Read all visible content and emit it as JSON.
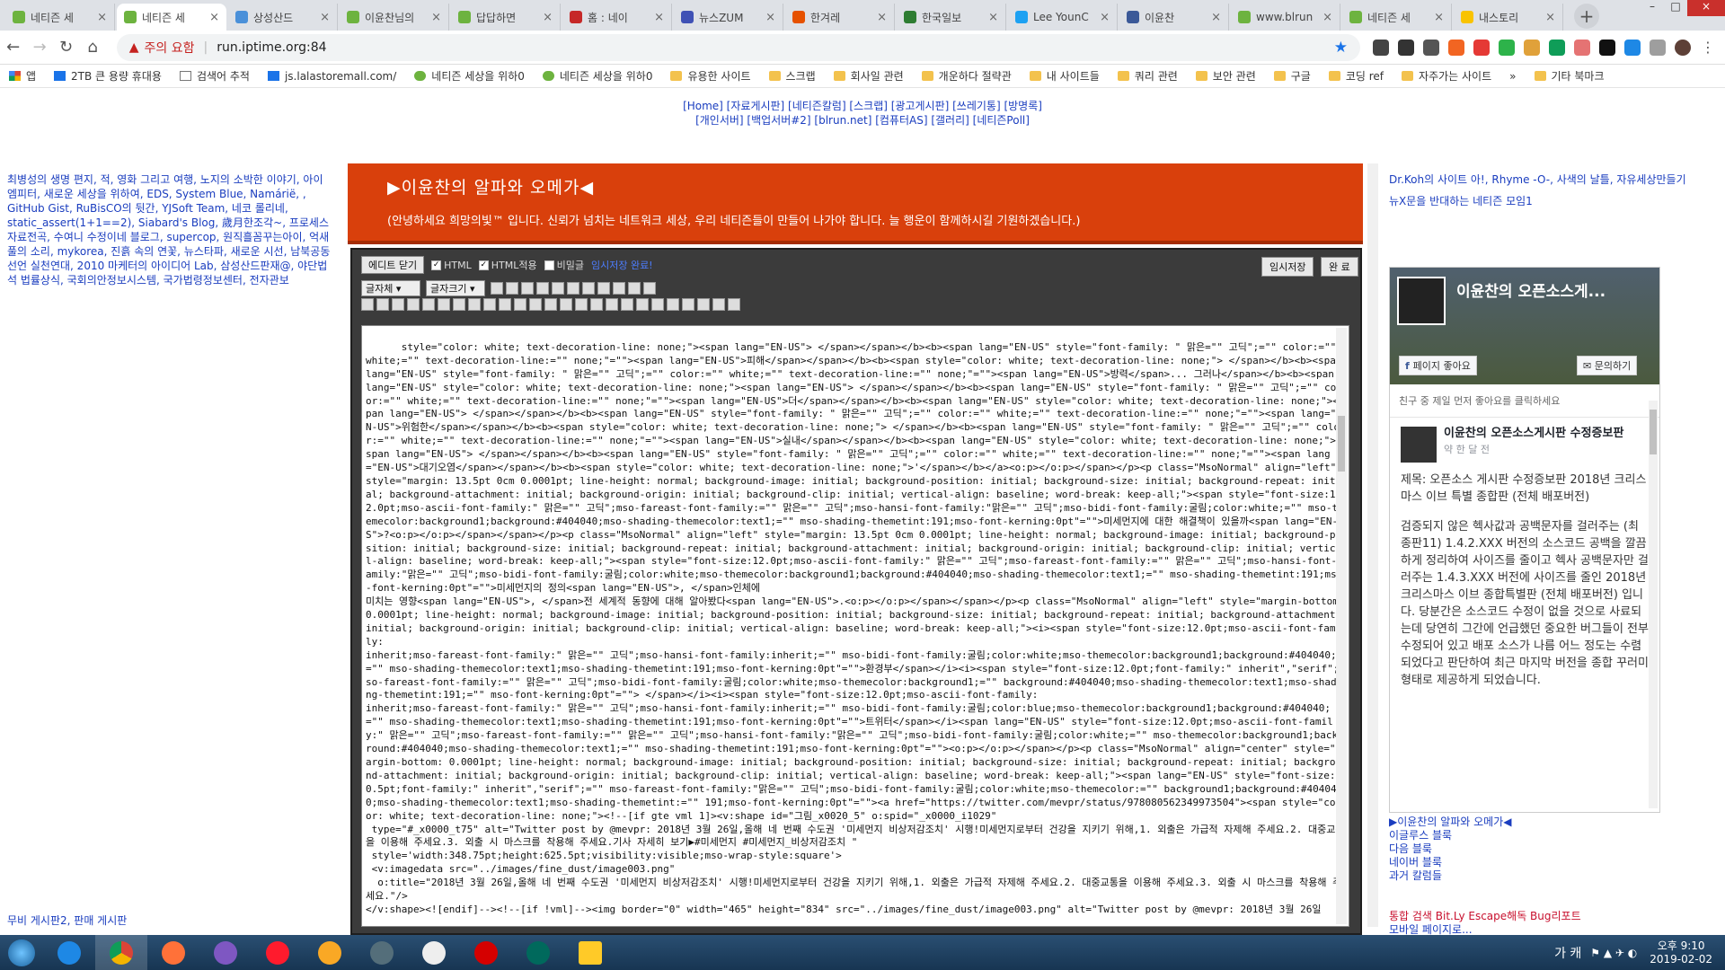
{
  "browser": {
    "tabs": [
      {
        "title": "네티즌 세",
        "color": "#6db33f",
        "icon": "leaf-icon"
      },
      {
        "title": "네티즌 세",
        "color": "#6db33f",
        "icon": "leaf-icon",
        "active": true
      },
      {
        "title": "상성산드",
        "color": "#4a90d9",
        "icon": "globe-icon"
      },
      {
        "title": "이윤찬님의",
        "color": "#6db33f",
        "icon": "leaf-icon"
      },
      {
        "title": "답답하면",
        "color": "#6db33f",
        "icon": "leaf-icon"
      },
      {
        "title": "홈 : 네이",
        "color": "#c62828",
        "icon": "shield-icon"
      },
      {
        "title": "뉴스ZUM",
        "color": "#3f51b5",
        "icon": "zum-icon"
      },
      {
        "title": "한겨레",
        "color": "#e65100",
        "icon": "newspaper-icon"
      },
      {
        "title": "한국일보",
        "color": "#2e7d32",
        "icon": "newspaper-icon"
      },
      {
        "title": "Lee YounC",
        "color": "#1da1f2",
        "icon": "twitter-icon"
      },
      {
        "title": "이윤찬",
        "color": "#3b5998",
        "icon": "facebook-icon"
      },
      {
        "title": "www.blrun",
        "color": "#6db33f",
        "icon": "leaf-icon"
      },
      {
        "title": "네티즌 세",
        "color": "#6db33f",
        "icon": "leaf-icon"
      },
      {
        "title": "내스토리",
        "color": "#f9c300",
        "icon": "story-icon"
      }
    ],
    "address": {
      "warning": "주의 요함",
      "url": "run.iptime.org:84"
    },
    "bookmarks": [
      {
        "label": "앱",
        "type": "apps"
      },
      {
        "label": "2TB 큰 용량 휴대용",
        "type": "u"
      },
      {
        "label": "검색어 추적",
        "type": "page"
      },
      {
        "label": "js.lalastoremall.com/",
        "type": "u"
      },
      {
        "label": "네티즌 세상을 위하0",
        "type": "leaf"
      },
      {
        "label": "네티즌 세상을 위하0",
        "type": "leaf"
      },
      {
        "label": "유용한 사이트",
        "type": "folder"
      },
      {
        "label": "스크랩",
        "type": "folder"
      },
      {
        "label": "회사일 관련",
        "type": "folder"
      },
      {
        "label": "개운하다 절략관",
        "type": "folder"
      },
      {
        "label": "내 사이트들",
        "type": "folder"
      },
      {
        "label": "쿼리 관련",
        "type": "folder"
      },
      {
        "label": "보안 관련",
        "type": "folder"
      },
      {
        "label": "구글",
        "type": "folder"
      },
      {
        "label": "코딩 ref",
        "type": "folder"
      },
      {
        "label": "자주가는 사이트",
        "type": "folder"
      },
      {
        "label": "»",
        "type": "more"
      },
      {
        "label": "기타 북마크",
        "type": "folder"
      }
    ]
  },
  "site": {
    "toplinks_line1": "[Home] [자료게시판] [네티즌칼럼] [스크랩] [광고게시판] [쓰레기통] [방명록]",
    "toplinks_line2": "[개인서버] [백업서버#2] [blrun.net] [컴퓨터AS] [갤러리] [네티즌Poll]",
    "leftcol": "최병성의 생명 편지, 적, 영화 그리고 여행, 노지의 소박한 이야기, 아이엠피터, 새로운 세상을 위하여, EDS, System Blue, Namárië, , GitHub Gist, RuBisCO의 뒷간, YJSoft Team, 네코 롤리네, static_assert(1+1==2), Siabard's Blog, 歲月한조각~, 프로세스 자료전곡, 수여니 수정이네 블로그, supercop, 원직흘꼼꾸는아이, 억새풀의 소리, mykorea, 진흙 속의 연꽃, 뉴스타파, 새로운 시선, 남북공동선언 실천연대, 2010 마케터의 아이디어 Lab, 삼성산드판재@, 야단법석 법률상식, 국회의안정보시스템, 국가법령정보센터, 전자관보",
    "leftbottom": "무비 게시판2, 판매 게시판",
    "header_title": "▶이윤찬의 알파와 오메가◀",
    "header_sub": "(안녕하세요 희망의빛™ 입니다. 신뢰가 넘치는 네트워크 세상, 우리 네티즌들이 만들어 나가야 합니다. 늘 행운이 함께하시길 기원하겠습니다.)",
    "rightcol_line1": "Dr.Koh의 사이트 아!, Rhyme -O-, 사색의 날틀, 자유세상만들기",
    "rightcol_line2": "뉴X문을 반대하는 네티즌 모임1"
  },
  "editor": {
    "close_btn": "에디트 닫기",
    "html_label": "HTML",
    "html_apply": "HTML적용",
    "secret": "비밀글",
    "saved_notice": "임시저장 완료!",
    "temp_save": "임시저장",
    "done": "완 료",
    "font_select": "글자체",
    "size_select": "글자크기",
    "code": "style=\"color: white; text-decoration-line: none;\"><span lang=\"EN-US\"> </span></span></b><b><span lang=\"EN-US\" style=\"font-family: \" 맑은=\"\" 고딕\";=\"\" color:=\"\" white;=\"\" text-decoration-line:=\"\" none;\"=\"\"><span lang=\"EN-US\">피해</span></span></b><b><span style=\"color: white; text-decoration-line: none;\"> </span></b><b><span lang=\"EN-US\" style=\"font-family: \" 맑은=\"\" 고딕\";=\"\" color:=\"\" white;=\"\" text-decoration-line:=\"\" none;\"=\"\"><span lang=\"EN-US\">방력</span>... 그러나</span></b><b><span lang=\"EN-US\" style=\"color: white; text-decoration-line: none;\"><span lang=\"EN-US\"> </span></span></b><b><span lang=\"EN-US\" style=\"font-family: \" 맑은=\"\" 고딕\";=\"\" color:=\"\" white;=\"\" text-decoration-line:=\"\" none;\"=\"\"><span lang=\"EN-US\">더</span></span></b><b><span lang=\"EN-US\" style=\"color: white; text-decoration-line: none;\"><span lang=\"EN-US\"> </span></span></b><b><span lang=\"EN-US\" style=\"font-family: \" 맑은=\"\" 고딕\";=\"\" color:=\"\" white;=\"\" text-decoration-line:=\"\" none;\"=\"\"><span lang=\"EN-US\">위험한</span></span></b><b><span style=\"color: white; text-decoration-line: none;\"> </span></b><b><span lang=\"EN-US\" style=\"font-family: \" 맑은=\"\" 고딕\";=\"\" color:=\"\" white;=\"\" text-decoration-line:=\"\" none;\"=\"\"><span lang=\"EN-US\">실내</span></span></b><b><span lang=\"EN-US\" style=\"color: white; text-decoration-line: none;\"><span lang=\"EN-US\"> </span></span></b><b><span lang=\"EN-US\" style=\"font-family: \" 맑은=\"\" 고딕\";=\"\" color:=\"\" white;=\"\" text-decoration-line:=\"\" none;\"=\"\"><span lang=\"EN-US\">대기오염</span></span></b><b><span style=\"color: white; text-decoration-line: none;\">'</span></b></a><o:p></o:p></span></p><p class=\"MsoNormal\" align=\"left\" style=\"margin: 13.5pt 0cm 0.0001pt; line-height: normal; background-image: initial; background-position: initial; background-size: initial; background-repeat: initial; background-attachment: initial; background-origin: initial; background-clip: initial; vertical-align: baseline; word-break: keep-all;\"><span style=\"font-size:12.0pt;mso-ascii-font-family:\" 맑은=\"\" 고딕\";mso-fareast-font-family:=\"\" 맑은=\"\" 고딕\";mso-hansi-font-family:\"맑은=\"\" 고딕\";mso-bidi-font-family:굴림;color:white;=\"\" mso-themecolor:background1;background:#404040;mso-shading-themecolor:text1;=\"\" mso-shading-themetint:191;mso-font-kerning:0pt\"=\"\">미세먼지에 대한 해결책이 있을까<span lang=\"EN-US\">?<o:p></o:p></span></span></p><p class=\"MsoNormal\" align=\"left\" style=\"margin: 13.5pt 0cm 0.0001pt; line-height: normal; background-image: initial; background-position: initial; background-size: initial; background-repeat: initial; background-attachment: initial; background-origin: initial; background-clip: initial; vertical-align: baseline; word-break: keep-all;\"><span style=\"font-size:12.0pt;mso-ascii-font-family:\" 맑은=\"\" 고딕\";mso-fareast-font-family:=\"\" 맑은=\"\" 고딕\";mso-hansi-font-family:\"맑은=\"\" 고딕\";mso-bidi-font-family:굴림;color:white;mso-themecolor:background1;background:#404040;mso-shading-themecolor:text1;=\"\" mso-shading-themetint:191;mso-font-kerning:0pt\"=\"\">미세먼지의 정의<span lang=\"EN-US\">, </span>인체에\n미치는 영향<span lang=\"EN-US\">, </span>전 세계적 동향에 대해 알아봤다<span lang=\"EN-US\">.<o:p></o:p></span></span></p><p class=\"MsoNormal\" align=\"left\" style=\"margin-bottom: 0.0001pt; line-height: normal; background-image: initial; background-position: initial; background-size: initial; background-repeat: initial; background-attachment: initial; background-origin: initial; background-clip: initial; vertical-align: baseline; word-break: keep-all;\"><i><span style=\"font-size:12.0pt;mso-ascii-font-family:\ninherit;mso-fareast-font-family:\" 맑은=\"\" 고딕\";mso-hansi-font-family:inherit;=\"\" mso-bidi-font-family:굴림;color:white;mso-themecolor:background1;background:#404040;=\"\" mso-shading-themecolor:text1;mso-shading-themetint:191;mso-font-kerning:0pt\"=\"\">환경부</span></i><i><span style=\"font-size:12.0pt;font-family:\" inherit\",\"serif\";mso-fareast-font-family:=\"\" 맑은=\"\" 고딕\";mso-bidi-font-family:굴림;color:white;mso-themecolor:background1;=\"\" background:#404040;mso-shading-themecolor:text1;mso-shading-themetint:191;=\"\" mso-font-kerning:0pt\"=\"\"> </span></i><i><span style=\"font-size:12.0pt;mso-ascii-font-family:\ninherit;mso-fareast-font-family:\" 맑은=\"\" 고딕\";mso-hansi-font-family:inherit;=\"\" mso-bidi-font-family:굴림;color:blue;mso-themecolor:background1;background:#404040;=\"\" mso-shading-themecolor:text1;mso-shading-themetint:191;mso-font-kerning:0pt\"=\"\">트위터</span></i><span lang=\"EN-US\" style=\"font-size:12.0pt;mso-ascii-font-family:\" 맑은=\"\" 고딕\";mso-fareast-font-family:=\"\" 맑은=\"\" 고딕\";mso-hansi-font-family:\"맑은=\"\" 고딕\";mso-bidi-font-family:굴림;color:white;=\"\" mso-themecolor:background1;background:#404040;mso-shading-themecolor:text1;=\"\" mso-shading-themetint:191;mso-font-kerning:0pt\"=\"\"><o:p></o:p></span></p><p class=\"MsoNormal\" align=\"center\" style=\"margin-bottom: 0.0001pt; line-height: normal; background-image: initial; background-position: initial; background-size: initial; background-repeat: initial; background-attachment: initial; background-origin: initial; background-clip: initial; vertical-align: baseline; word-break: keep-all;\"><span lang=\"EN-US\" style=\"font-size:10.5pt;font-family:\" inherit\",\"serif\";=\"\" mso-fareast-font-family:\"맑은=\"\" 고딕\";mso-bidi-font-family:굴림;color:white;mso-themecolor:=\"\" background1;background:#404040;mso-shading-themecolor:text1;mso-shading-themetint:=\"\" 191;mso-font-kerning:0pt\"=\"\"><a href=\"https://twitter.com/mevpr/status/978080562349973504\"><span style=\"color: white; text-decoration-line: none;\"><!--[if gte vml 1]><v:shape id=\"그림_x0020_5\" o:spid=\"_x0000_i1029\"\n type=\"#_x0000_t75\" alt=\"Twitter post by @mevpr: 2018년 3월 26일,올해 네 번째 수도권 '미세먼지 비상저감조치' 시행!미세먼지로부터 건강을 지키기 위해,1. 외출은 가급적 자제해 주세요.2. 대중교통을 이용해 주세요.3. 외출 시 마스크를 착용해 주세요.기사 자세히 보기▶#미세먼지 #미세먼지_비상저감조치 \"\n style='width:348.75pt;height:625.5pt;visibility:visible;mso-wrap-style:square'>\n <v:imagedata src=\"../images/fine_dust/image003.png\"\n  o:title=\"2018년 3월 26일,올해 네 번째 수도권 '미세먼지 비상저감조치' 시행!미세먼지로부터 건강을 지키기 위해,1. 외출은 가급적 자제해 주세요.2. 대중교통을 이용해 주세요.3. 외출 시 마스크를 착용해 주세요.\"/>\n</v:shape><![endif]--><!--[if !vml]--><img border=\"0\" width=\"465\" height=\"834\" src=\"../images/fine_dust/image003.png\" alt=\"Twitter post by @mevpr: 2018년 3월 26일"
  },
  "facebook": {
    "cover_name": "이윤찬의 오픈소스게...",
    "like_btn": "페이지 좋아요",
    "msg_btn": "문의하기",
    "friends": "친구 중 제일 먼저 좋아요를 클릭하세요",
    "post_name": "이윤찬의 오픈소스게시판 수정증보판",
    "post_time": "약 한 달 전",
    "p1": "제목: 오픈소스 게시판 수정증보판 2018년 크리스마스 이브 특별 종합판 (전체 배포버전)",
    "p2": "검증되지 않은 헥사값과 공백문자를 걸러주는 (최종판11) 1.4.2.XXX 버전의 소스코드 공백을 깔끔하게 정리하여 사이즈를 줄이고 헥사 공백문자만 걸러주는 1.4.3.XXX 버전에 사이즈를 줄인 2018년 크리스마스 이브 종합특별판 (전체 배포버전) 입니다. 당분간은 소스코드 수정이 없을 것으로 사료되는데 당연히 그간에 언급했던 중요한 버그들이 전부 수정되어 있고 배포 소스가 나름 어느 정도는 수렴되었다고 판단하여 최근 마지막 버전을 종합 꾸러미 형태로 제공하게 되었습니다."
  },
  "rightlinks": {
    "l1": "▶이윤찬의 알파와 오메가◀",
    "l2": "이글루스 블룩",
    "l3": "다음 블룩",
    "l4": "네이버 블룩",
    "l5": "과거 칼럼들",
    "l6": "통합 검색 Bit.Ly Escape해독 Bug리포트",
    "l7": "모바일 페이지로..."
  },
  "taskbar": {
    "ime": "가 캐",
    "time": "오후 9:10",
    "date": "2019-02-02"
  }
}
